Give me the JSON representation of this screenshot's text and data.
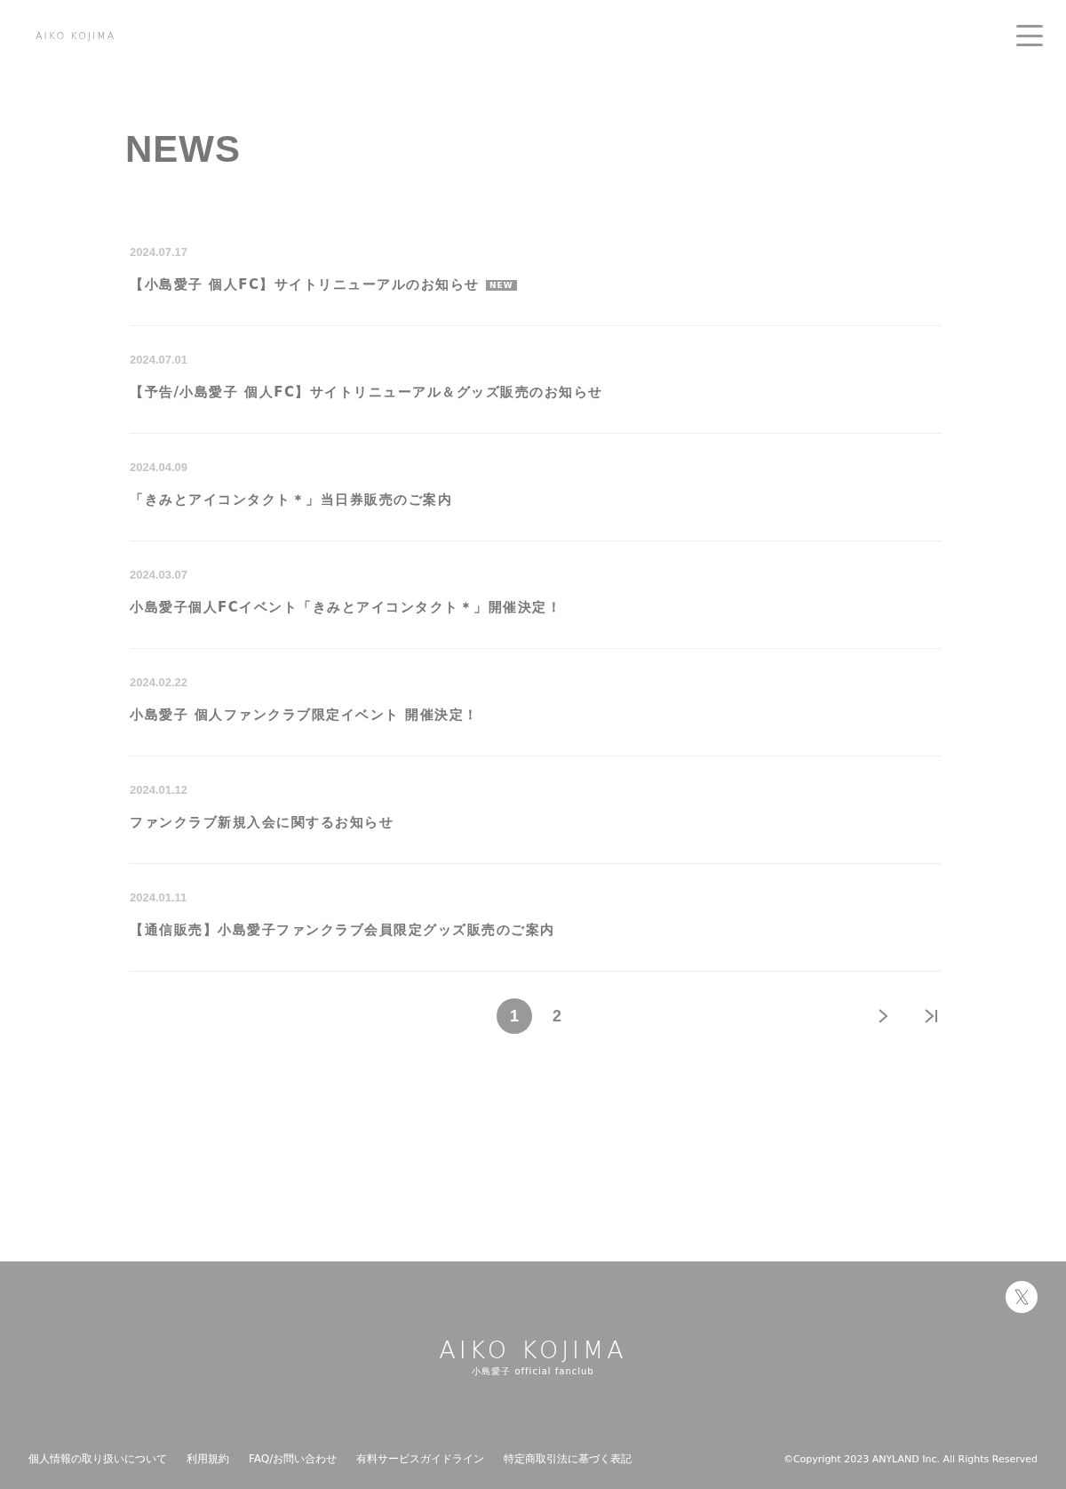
{
  "header": {
    "logo": "AIKO KOJIMA"
  },
  "page_title": "NEWS",
  "news": [
    {
      "date": "2024.07.17",
      "title": "【小島愛子 個人FC】サイトリニューアルのお知らせ",
      "badge": "NEW"
    },
    {
      "date": "2024.07.01",
      "title": "【予告/小島愛子 個人FC】サイトリニューアル＆グッズ販売のお知らせ"
    },
    {
      "date": "2024.04.09",
      "title": "「きみとアイコンタクト＊」当日券販売のご案内"
    },
    {
      "date": "2024.03.07",
      "title": "小島愛子個人FCイベント「きみとアイコンタクト＊」開催決定！"
    },
    {
      "date": "2024.02.22",
      "title": "小島愛子 個人ファンクラブ限定イベント 開催決定！"
    },
    {
      "date": "2024.01.12",
      "title": "ファンクラブ新規入会に関するお知らせ"
    },
    {
      "date": "2024.01.11",
      "title": "【通信販売】小島愛子ファンクラブ会員限定グッズ販売のご案内"
    }
  ],
  "pagination": {
    "pages": [
      {
        "label": "1",
        "selected": true
      },
      {
        "label": "2",
        "selected": false
      }
    ]
  },
  "footer": {
    "logo": "AIKO KOJIMA",
    "logo_sub": "小島愛子 official fanclub",
    "links": [
      "個人情報の取り扱いについて",
      "利用規約",
      "FAQ/お問い合わせ",
      "有料サービスガイドライン",
      "特定商取引法に基づく表記"
    ],
    "copyright": "©Copyright 2023 ANYLAND Inc. All Rights Reserved"
  }
}
